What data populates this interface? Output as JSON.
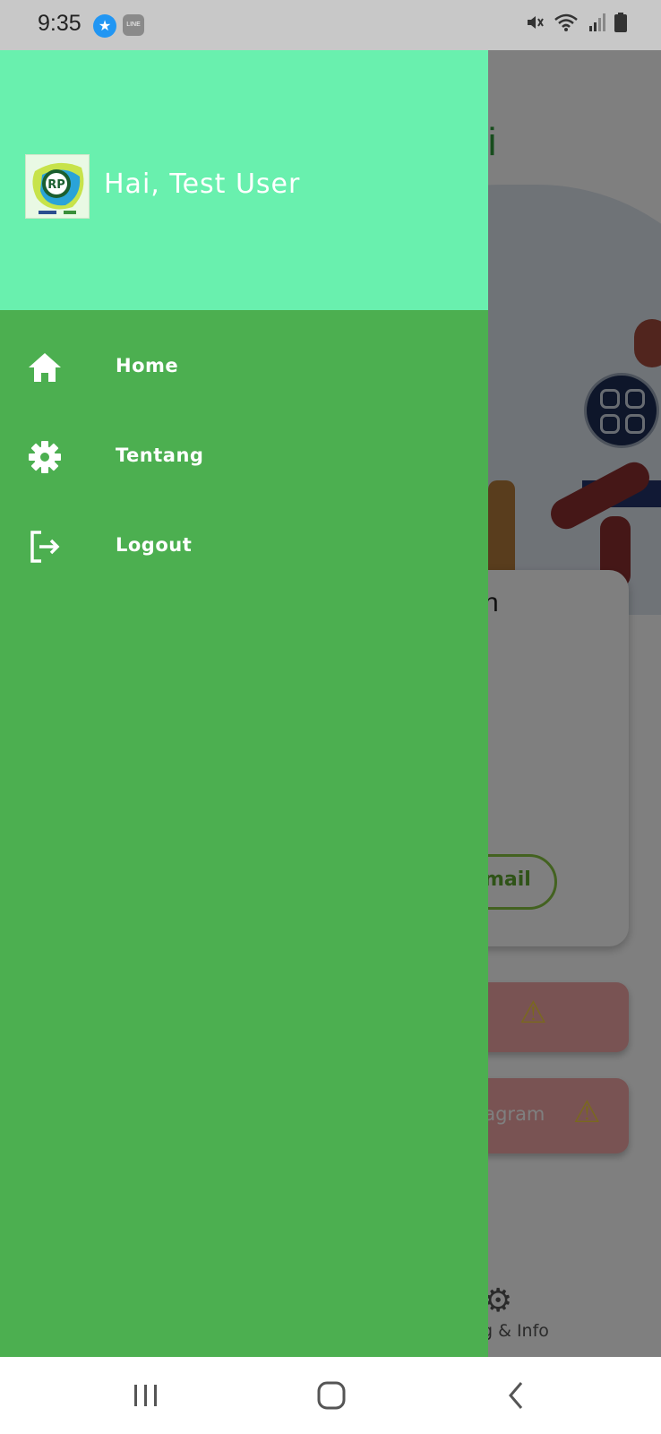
{
  "status_bar": {
    "time": "9:35",
    "notification_line_label": "LINE"
  },
  "drawer": {
    "greeting": "Hai, Test User",
    "header_color": "#69f0ae",
    "body_color": "#4caf50",
    "avatar_logo_text": "RP",
    "items": [
      {
        "label": "Home",
        "icon": "home-icon"
      },
      {
        "label": "Tentang",
        "icon": "gear-icon"
      },
      {
        "label": "Logout",
        "icon": "logout-icon"
      }
    ]
  },
  "background_app": {
    "title_fragment": "ri",
    "card_letter": "n",
    "email_button_fragment": "mail",
    "alert_instagram_fragment": "tagram",
    "bottom_tab_label_fragment": "g & Info"
  },
  "nav_bar": {
    "buttons": [
      "recent-apps",
      "home",
      "back"
    ]
  }
}
